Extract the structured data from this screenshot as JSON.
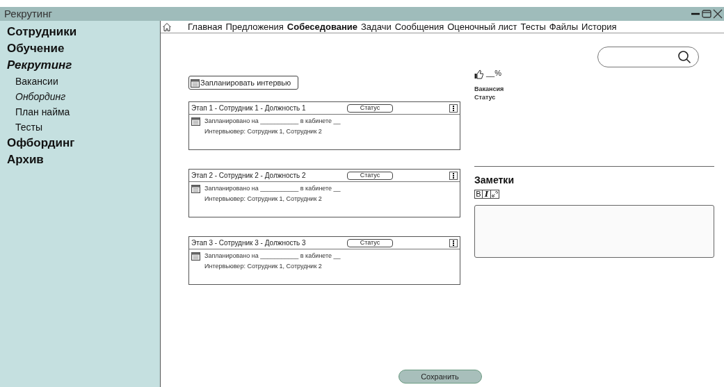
{
  "window": {
    "title": "Рекрутинг"
  },
  "sidebar": {
    "items": [
      {
        "label": "Сотрудники",
        "selected": false
      },
      {
        "label": "Обучение",
        "selected": false
      },
      {
        "label": "Рекрутинг",
        "selected": true,
        "children": [
          {
            "label": "Вакансии",
            "selected": false
          },
          {
            "label": "Онбординг",
            "selected": true
          },
          {
            "label": "План найма",
            "selected": false
          },
          {
            "label": "Тесты",
            "selected": false
          }
        ]
      },
      {
        "label": "Офбординг",
        "selected": false
      },
      {
        "label": "Архив",
        "selected": false
      }
    ]
  },
  "tabs": [
    {
      "label": "Главная",
      "selected": false
    },
    {
      "label": "Предложения",
      "selected": false
    },
    {
      "label": "Собеседование",
      "selected": true
    },
    {
      "label": "Задачи",
      "selected": false
    },
    {
      "label": "Сообщения",
      "selected": false
    },
    {
      "label": "Оценочный лист",
      "selected": false
    },
    {
      "label": "Тесты",
      "selected": false
    },
    {
      "label": "Файлы",
      "selected": false
    },
    {
      "label": "История",
      "selected": false
    }
  ],
  "schedule_button": "Запланировать интервью",
  "interviews": [
    {
      "title": "Этап 1 - Сотрудник 1 - Должность 1",
      "status": "Статус",
      "scheduled": "Запланировано на ___________ в кабинете __",
      "interviewer": "Интервьювер: Сотрудник 1, Сотрудник 2"
    },
    {
      "title": "Этап 2 - Сотрудник 2 - Должность 2",
      "status": "Статус",
      "scheduled": "Запланировано на ___________ в кабинете __",
      "interviewer": "Интервьювер: Сотрудник 1, Сотрудник 2"
    },
    {
      "title": "Этап 3 - Сотрудник 3 - Должность 3",
      "status": "Статус",
      "scheduled": "Запланировано на ___________ в кабинете __",
      "interviewer": "Интервьювер: Сотрудник 1, Сотрудник 2"
    }
  ],
  "summary": {
    "rating": "__%",
    "vacancy": "Вакансия",
    "status": "Статус"
  },
  "notes": {
    "title": "Заметки",
    "bold_button": "B",
    "italic_button": "I"
  },
  "save_button": "Сохранить"
}
